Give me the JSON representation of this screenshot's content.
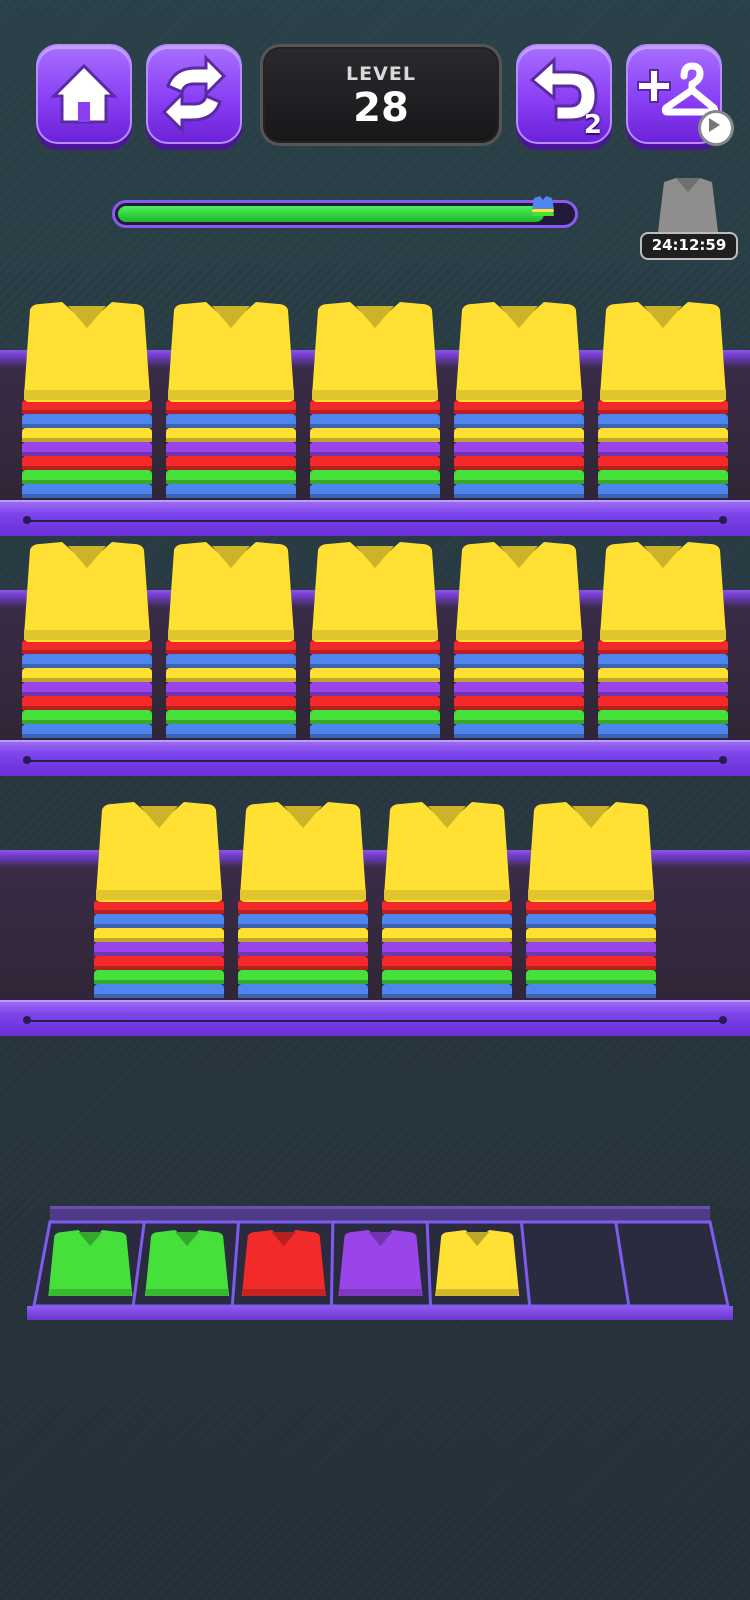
{
  "header": {
    "level_label": "LEVEL",
    "level_number": "28",
    "undo_count": "2",
    "timer": "24:12:59",
    "progress": 0.96
  },
  "buttons": [
    "home-icon",
    "refresh-icon",
    "undo-icon",
    "add-hanger-icon"
  ],
  "shelves": [
    {
      "stacks": 5,
      "layers": [
        "red",
        "blue",
        "yellow",
        "purple",
        "red",
        "green",
        "blue"
      ]
    },
    {
      "stacks": 5,
      "layers": [
        "red",
        "blue",
        "yellow",
        "purple",
        "red",
        "green",
        "blue"
      ]
    },
    {
      "stacks": 4,
      "layers": [
        "red",
        "blue",
        "yellow",
        "purple",
        "red",
        "green",
        "blue"
      ]
    }
  ],
  "tray": {
    "slots": 7,
    "items": [
      "green",
      "green",
      "red",
      "purple",
      "yellow"
    ]
  },
  "colors": {
    "yellow": "#ffe033",
    "red": "#f22a2a",
    "blue": "#4f86ee",
    "purple": "#9a45ea",
    "green": "#45e03a",
    "accent": "#8a3ff5"
  }
}
